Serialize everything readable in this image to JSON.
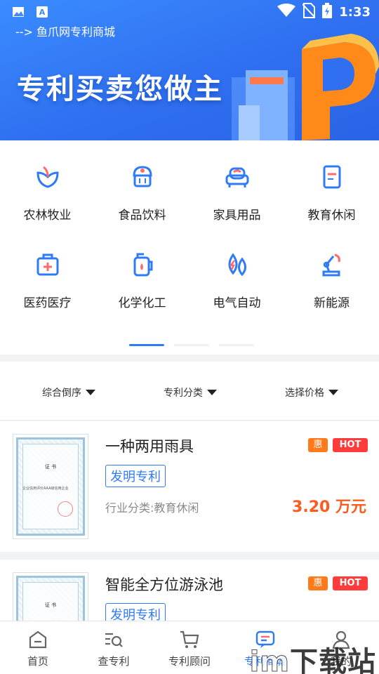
{
  "status_bar": {
    "time": "1:33",
    "icons": [
      "image-icon",
      "text-a-icon",
      "wifi-icon",
      "no-sim-icon",
      "battery-icon"
    ]
  },
  "header": {
    "breadcrumb": "--> 鱼爪网专利商城",
    "slogan": "专利买卖您做主"
  },
  "categories": [
    {
      "label": "农林牧业",
      "icon": "leaf-icon"
    },
    {
      "label": "食品饮料",
      "icon": "cupcake-icon"
    },
    {
      "label": "家具用品",
      "icon": "sofa-icon"
    },
    {
      "label": "教育休闲",
      "icon": "book-icon"
    },
    {
      "label": "医药医疗",
      "icon": "medical-kit-icon"
    },
    {
      "label": "化学化工",
      "icon": "chemical-jug-icon"
    },
    {
      "label": "电气自动",
      "icon": "electric-drop-icon"
    },
    {
      "label": "新能源",
      "icon": "robot-arm-icon"
    }
  ],
  "filters": [
    {
      "label": "综合倒序"
    },
    {
      "label": "专利分类"
    },
    {
      "label": "选择价格"
    }
  ],
  "products": [
    {
      "title": "一种两用雨具",
      "type": "发明专利",
      "category": "行业分类:教育休闲",
      "price": "3.20 万元",
      "tag_hui": "惠",
      "tag_hot": "HOT",
      "cert_title": "证 书",
      "cert_text": "企业信用评价AAA级信用企业"
    },
    {
      "title": "智能全方位游泳池",
      "type": "发明专利",
      "category": "",
      "price": "",
      "tag_hui": "惠",
      "tag_hot": "HOT",
      "cert_title": "证 书",
      "cert_text": ""
    }
  ],
  "bottom_nav": [
    {
      "label": "首页",
      "icon": "home-icon",
      "active": false
    },
    {
      "label": "查专利",
      "icon": "search-list-icon",
      "active": false
    },
    {
      "label": "专利顾问",
      "icon": "cart-icon",
      "active": false
    },
    {
      "label": "专利商城",
      "icon": "chat-list-icon",
      "active": true
    },
    {
      "label": "我的",
      "icon": "user-icon",
      "active": false
    }
  ],
  "watermark": {
    "text_a": "im",
    "text_b": "下载站"
  },
  "colors": {
    "accent": "#2f7bf5",
    "price": "#ff5a1f",
    "hot": "#ff3b3b",
    "hui": "#ff7a1a"
  }
}
